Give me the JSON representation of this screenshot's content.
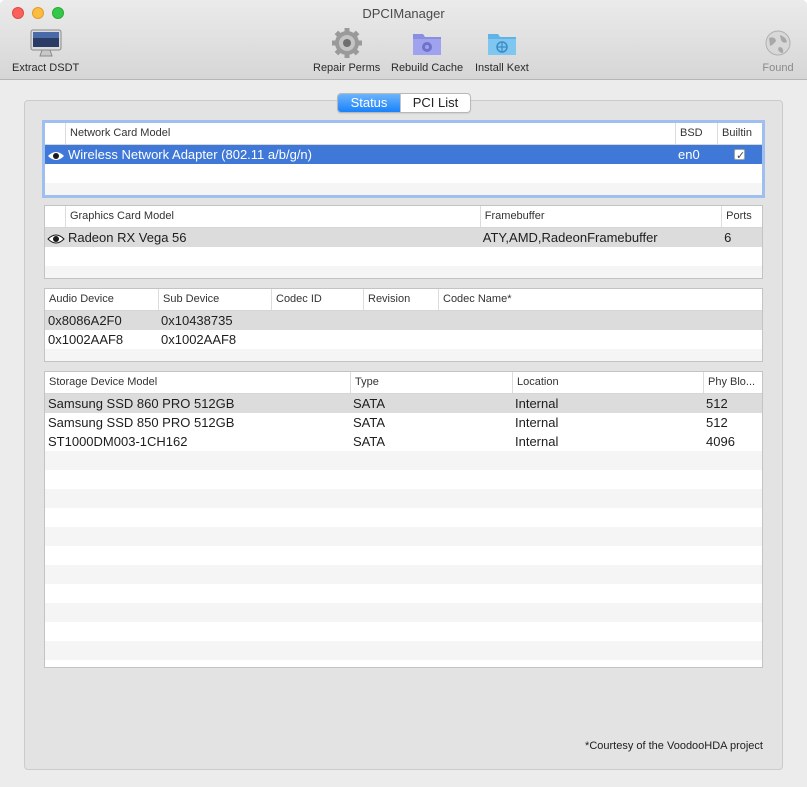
{
  "window": {
    "title": "DPCIManager"
  },
  "toolbar": {
    "extract_dsdt": {
      "label": "Extract DSDT",
      "icon": "imac-icon"
    },
    "repair_perms": {
      "label": "Repair Perms",
      "icon": "gear-icon"
    },
    "rebuild_cache": {
      "label": "Rebuild Cache",
      "icon": "folder-gear-icon"
    },
    "install_kext": {
      "label": "Install Kext",
      "icon": "folder-kext-icon"
    },
    "found": {
      "label": "Found",
      "icon": "globe-icon"
    }
  },
  "tabs": {
    "status": "Status",
    "pci_list": "PCI List",
    "active": "Status"
  },
  "network": {
    "headers": {
      "model": "Network Card Model",
      "bsd": "BSD",
      "builtin": "Builtin"
    },
    "rows": [
      {
        "model": "Wireless Network Adapter (802.11 a/b/g/n)",
        "bsd": "en0",
        "builtin": true
      }
    ]
  },
  "graphics": {
    "headers": {
      "model": "Graphics Card Model",
      "framebuffer": "Framebuffer",
      "ports": "Ports"
    },
    "rows": [
      {
        "model": "Radeon RX Vega 56",
        "framebuffer": "ATY,AMD,RadeonFramebuffer",
        "ports": "6"
      }
    ]
  },
  "audio": {
    "headers": {
      "device": "Audio Device",
      "sub_device": "Sub Device",
      "codec_id": "Codec ID",
      "revision": "Revision",
      "codec_name": "Codec Name*"
    },
    "rows": [
      {
        "device": "0x8086A2F0",
        "sub_device": "0x10438735"
      },
      {
        "device": "0x1002AAF8",
        "sub_device": "0x1002AAF8"
      }
    ]
  },
  "storage": {
    "headers": {
      "model": "Storage Device Model",
      "type": "Type",
      "location": "Location",
      "phy_block": "Phy Blo..."
    },
    "rows": [
      {
        "model": "Samsung SSD 860 PRO 512GB",
        "type": "SATA",
        "location": "Internal",
        "phy_block": "512"
      },
      {
        "model": "Samsung SSD 850 PRO 512GB",
        "type": "SATA",
        "location": "Internal",
        "phy_block": "512"
      },
      {
        "model": "ST1000DM003-1CH162",
        "type": "SATA",
        "location": "Internal",
        "phy_block": "4096"
      }
    ]
  },
  "footnote": "*Courtesy of the VoodooHDA project",
  "colors": {
    "selection": "#3f78d6",
    "segment_active": "#1a82fb",
    "focus_ring": "#9fbff0"
  }
}
